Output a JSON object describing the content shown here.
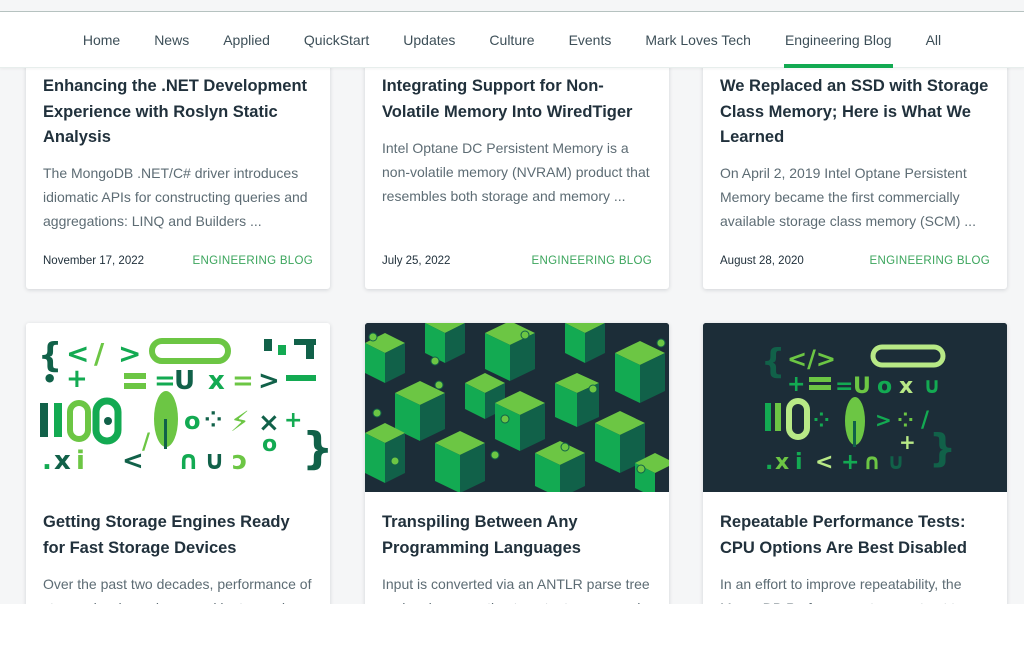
{
  "nav": {
    "items": [
      {
        "label": "Home"
      },
      {
        "label": "News"
      },
      {
        "label": "Applied"
      },
      {
        "label": "QuickStart"
      },
      {
        "label": "Updates"
      },
      {
        "label": "Culture"
      },
      {
        "label": "Events"
      },
      {
        "label": "Mark Loves Tech"
      },
      {
        "label": "Engineering Blog",
        "active": true
      },
      {
        "label": "All"
      }
    ]
  },
  "colors": {
    "accent": "#13aa52",
    "tag": "#3ba55c",
    "dark_thumb_bg": "#1c2d38"
  },
  "cards": [
    {
      "title": "Enhancing the .NET Development Experience with Roslyn Static Analysis",
      "description": "The MongoDB .NET/C# driver introduces idiomatic APIs for constructing queries and aggregations: LINQ and Builders ...",
      "date": "November 17, 2022",
      "tag": "ENGINEERING BLOG"
    },
    {
      "title": "Integrating Support for Non-Volatile Memory Into WiredTiger",
      "description": "Intel Optane DC Persistent Memory is a non-volatile memory (NVRAM) product that resembles both storage and memory ...",
      "date": "July 25, 2022",
      "tag": "ENGINEERING BLOG"
    },
    {
      "title": "We Replaced an SSD with Storage Class Memory; Here is What We Learned",
      "description": "On April 2, 2019 Intel Optane Persistent Memory became the first commercially available storage class memory (SCM) ...",
      "date": "August 28, 2020",
      "tag": "ENGINEERING BLOG"
    },
    {
      "title": "Getting Storage Engines Ready for Fast Storage Devices",
      "description": "Over the past two decades, performance of storage hardware increased by two orders of magnitude."
    },
    {
      "title": "Transpiling Between Any Programming Languages",
      "description": "Input is converted via an ANTLR parse tree and code generation to output source code."
    },
    {
      "title": "Repeatable Performance Tests: CPU Options Are Best Disabled",
      "description": "In an effort to improve repeatability, the MongoDB Performance team set out to reduce noise."
    }
  ]
}
